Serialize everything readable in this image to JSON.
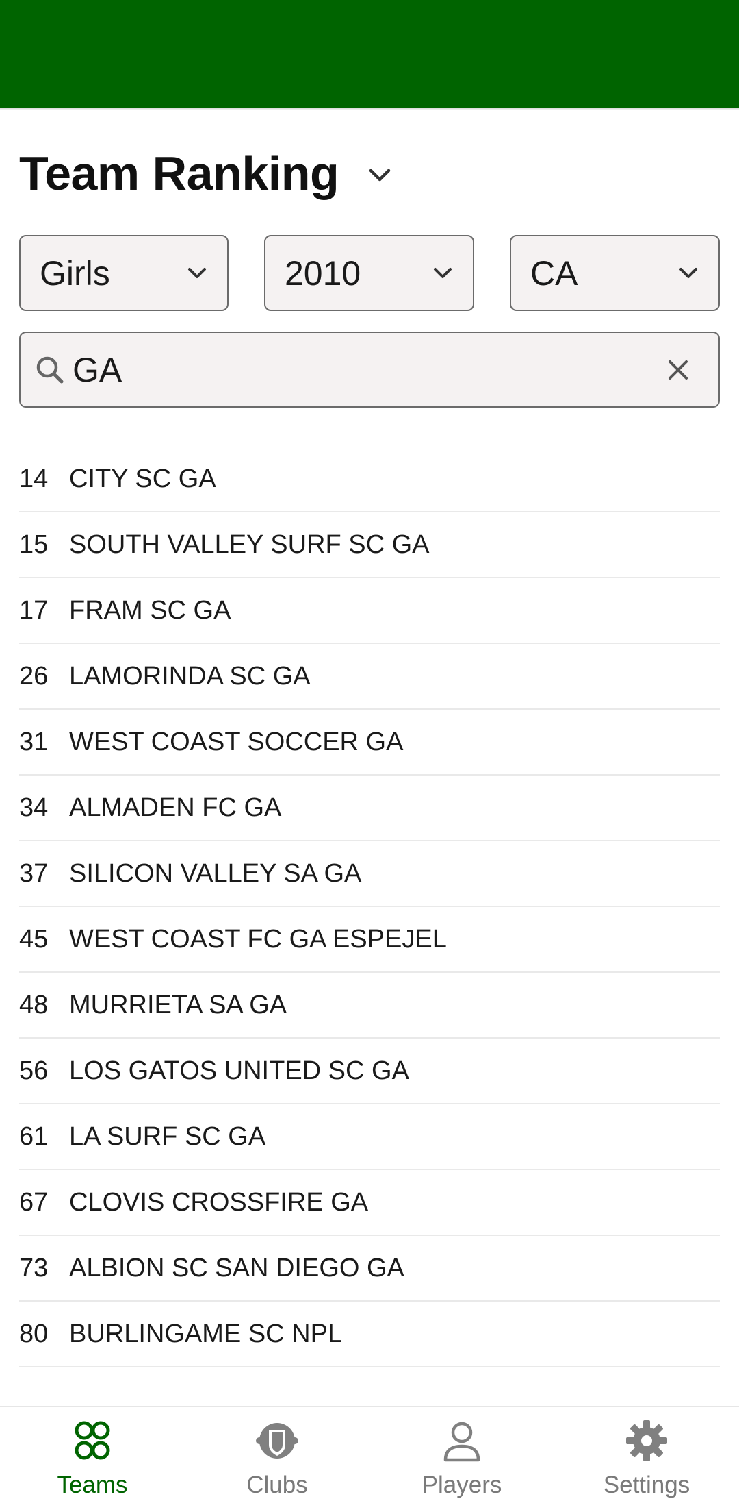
{
  "colors": {
    "app_bar": "#006400",
    "active_nav": "#006400",
    "inactive_nav": "#7a7a7a"
  },
  "header": {
    "title": "Team Ranking",
    "title_icon": "chevron-down-icon"
  },
  "filters": [
    {
      "label": "Girls",
      "icon": "chevron-down-icon"
    },
    {
      "label": "2010",
      "icon": "chevron-down-icon"
    },
    {
      "label": "CA",
      "icon": "chevron-down-icon"
    }
  ],
  "search": {
    "value": "GA",
    "icon": "search-icon",
    "clear_icon": "close-icon"
  },
  "teams": [
    {
      "rank": "14",
      "name": "CITY SC GA"
    },
    {
      "rank": "15",
      "name": "SOUTH VALLEY SURF SC GA"
    },
    {
      "rank": "17",
      "name": "FRAM SC GA"
    },
    {
      "rank": "26",
      "name": "LAMORINDA SC GA"
    },
    {
      "rank": "31",
      "name": "WEST COAST SOCCER GA"
    },
    {
      "rank": "34",
      "name": "ALMADEN FC GA"
    },
    {
      "rank": "37",
      "name": "SILICON VALLEY SA GA"
    },
    {
      "rank": "45",
      "name": "WEST COAST FC GA ESPEJEL"
    },
    {
      "rank": "48",
      "name": "MURRIETA SA GA"
    },
    {
      "rank": "56",
      "name": "LOS GATOS UNITED SC GA"
    },
    {
      "rank": "61",
      "name": "LA SURF SC GA"
    },
    {
      "rank": "67",
      "name": "CLOVIS CROSSFIRE GA"
    },
    {
      "rank": "73",
      "name": "ALBION SC SAN DIEGO GA"
    },
    {
      "rank": "80",
      "name": "BURLINGAME SC NPL"
    }
  ],
  "nav": [
    {
      "label": "Teams",
      "icon": "teams-icon",
      "active": true
    },
    {
      "label": "Clubs",
      "icon": "clubs-icon",
      "active": false
    },
    {
      "label": "Players",
      "icon": "player-icon",
      "active": false
    },
    {
      "label": "Settings",
      "icon": "gear-icon",
      "active": false
    }
  ]
}
